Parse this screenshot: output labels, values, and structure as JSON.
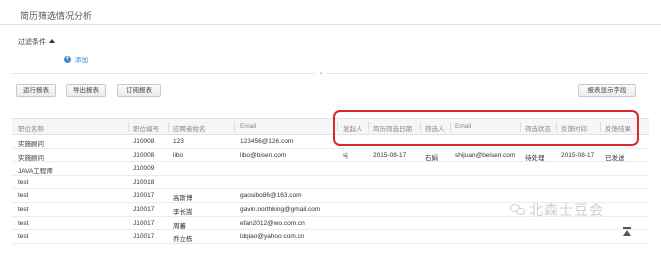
{
  "page": {
    "title": "简历筛选情况分析"
  },
  "filter": {
    "label": "过滤条件",
    "add_label": "添加"
  },
  "toolbar": {
    "run_label": "运行报表",
    "export_label": "导出报表",
    "subscribe_label": "订阅报表",
    "display_label": "报表显示字段"
  },
  "table": {
    "headers": [
      "职位名称",
      "职位编号",
      "应聘者姓名",
      "Email",
      "发起人",
      "简历筛选日期",
      "筛选人",
      "Email",
      "筛选状态",
      "反馈时间",
      "反馈结果"
    ],
    "rows": [
      [
        "实施顾问",
        "J10008",
        "123",
        "123456@126.com",
        "",
        "",
        "",
        "",
        "",
        "",
        ""
      ],
      [
        "实施顾问",
        "J10008",
        "libo",
        "libo@bisen.com",
        "sj",
        "2015-08-17",
        "石娟",
        "shijuan@beisen.com",
        "待处理",
        "2015-08-17",
        "已发送"
      ],
      [
        "JAVA工程师",
        "J10009",
        "",
        "",
        "",
        "",
        "",
        "",
        "",
        "",
        ""
      ],
      [
        "test",
        "J10018",
        "",
        "",
        "",
        "",
        "",
        "",
        "",
        "",
        ""
      ],
      [
        "test",
        "J10017",
        "高斯博",
        "gaosibo86@163.com",
        "",
        "",
        "",
        "",
        "",
        "",
        ""
      ],
      [
        "test",
        "J10017",
        "李长嵩",
        "gavin.northking@gmail.com",
        "",
        "",
        "",
        "",
        "",
        "",
        ""
      ],
      [
        "test",
        "J10017",
        "周蕃",
        "efan2012@wo.com.cn",
        "",
        "",
        "",
        "",
        "",
        "",
        ""
      ],
      [
        "test",
        "J10017",
        "乔立栋",
        "ldqiao@yahoo.com.cn",
        "",
        "",
        "",
        "",
        "",
        "",
        ""
      ]
    ]
  },
  "watermark": {
    "text": "北森士豆会"
  },
  "colors": {
    "highlight": "#d8282b",
    "link": "#3c8bd6"
  }
}
